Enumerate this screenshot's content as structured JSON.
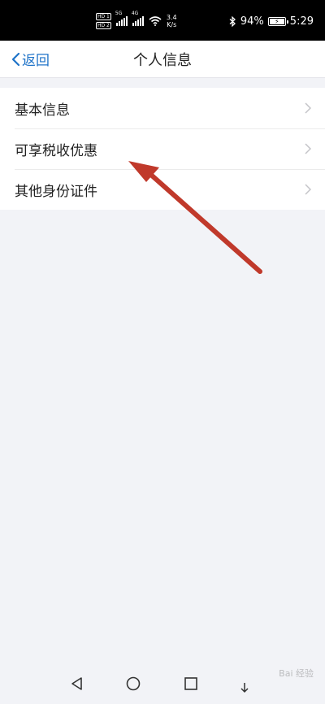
{
  "status_bar": {
    "network_speed_value": "3.4",
    "network_speed_unit": "K/s",
    "sim1_badge": "HD 1",
    "sim2_badge": "HD 2",
    "sig1_label": "5G",
    "sig2_label": "4G",
    "battery": "94%",
    "battery_level": 0.94,
    "time": "5:29"
  },
  "nav": {
    "back_label": "返回",
    "title": "个人信息"
  },
  "menu": {
    "items": [
      {
        "label": "基本信息"
      },
      {
        "label": "可享税收优惠"
      },
      {
        "label": "其他身份证件"
      }
    ]
  },
  "watermark": "Bai 经验",
  "colors": {
    "accent": "#1f73c8",
    "annotation_arrow": "#c0392b",
    "background": "#f2f3f7"
  }
}
